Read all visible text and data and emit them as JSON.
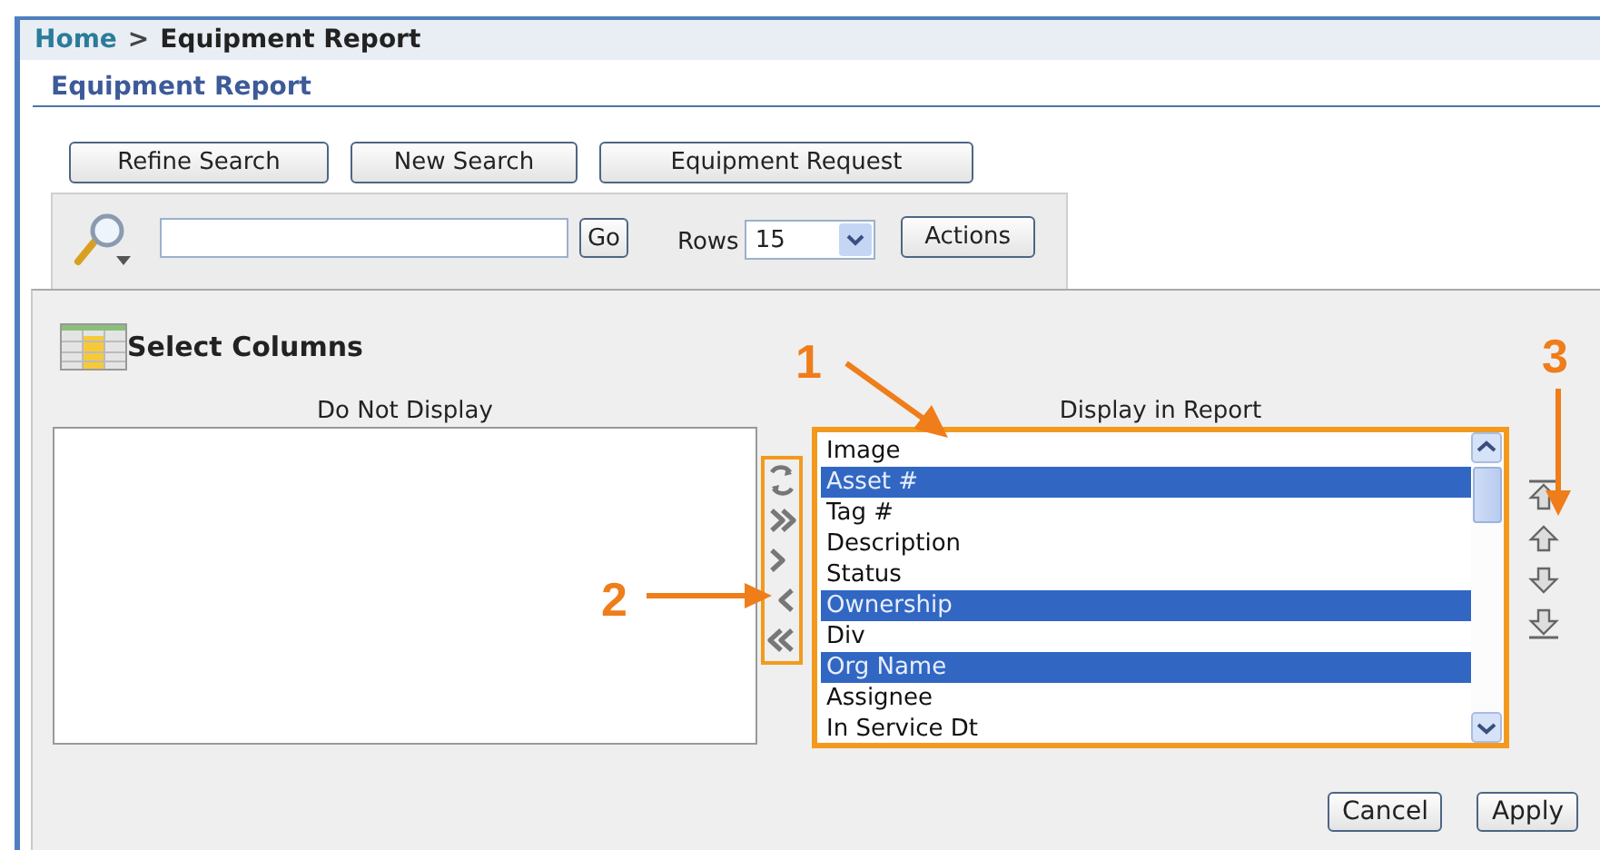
{
  "breadcrumb": {
    "home": "Home",
    "separator": ">",
    "current": "Equipment Report"
  },
  "page_title": "Equipment Report",
  "buttons": [
    "Refine Search",
    "New Search",
    "Equipment Request"
  ],
  "search": {
    "go": "Go",
    "rows_label": "Rows",
    "rows_value": "15",
    "actions": "Actions"
  },
  "select_columns": {
    "title": "Select Columns",
    "do_not_display": {
      "heading": "Do Not Display"
    },
    "display_in_report": {
      "heading": "Display in Report",
      "items": [
        {
          "label": "Image",
          "selected": false
        },
        {
          "label": "Asset #",
          "selected": true
        },
        {
          "label": "Tag #",
          "selected": false
        },
        {
          "label": "Description",
          "selected": false
        },
        {
          "label": "Status",
          "selected": false
        },
        {
          "label": "Ownership",
          "selected": true
        },
        {
          "label": "Div",
          "selected": false
        },
        {
          "label": "Org Name",
          "selected": true
        },
        {
          "label": "Assignee",
          "selected": false
        },
        {
          "label": "In Service Dt",
          "selected": false
        }
      ]
    }
  },
  "footer_buttons": [
    "Cancel",
    "Apply"
  ],
  "callouts": [
    "1",
    "2",
    "3"
  ]
}
